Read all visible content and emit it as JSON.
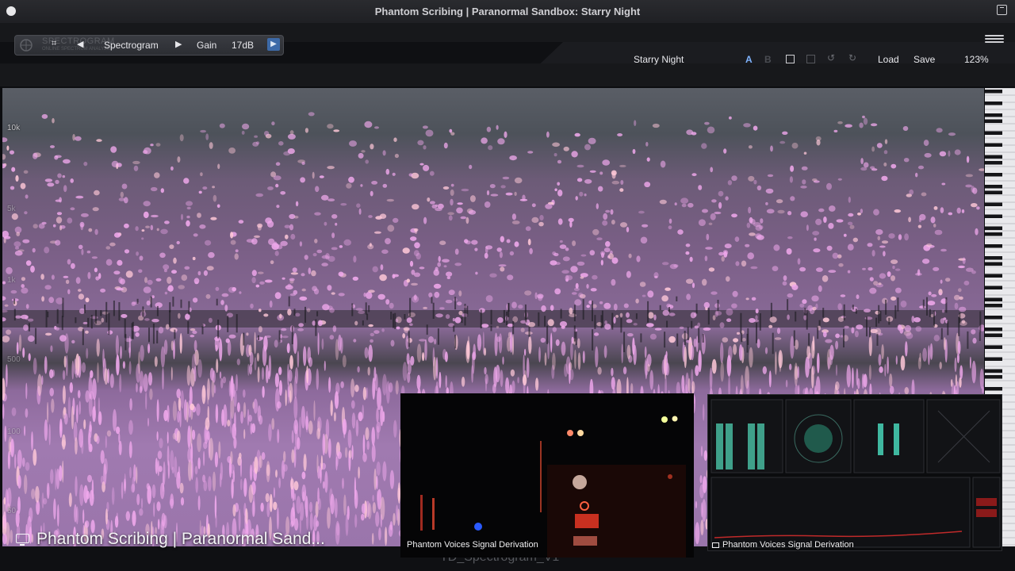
{
  "window": {
    "title": "Phantom Scribing | Paranormal Sandbox: Starry Night"
  },
  "toolbar": {
    "ghost_brand": "SPECTROGRAM",
    "ghost_sub": "ONLINE SPECTRUM ANALYZER",
    "view_label": "Spectrogram",
    "gain_label": "Gain",
    "gain_value": "17dB"
  },
  "preset": {
    "name": "Starry Night",
    "ab_a": "A",
    "ab_b": "B",
    "load_label": "Load",
    "save_label": "Save",
    "zoom": "123%"
  },
  "spectrogram": {
    "freq_labels": [
      "10k",
      "5k",
      "1k",
      "500",
      "100",
      "50"
    ]
  },
  "bottom": {
    "stream_title": "Phantom Scribing | Paranormal Sand...",
    "filename": "TD_Spectrogram_V1"
  },
  "overlays": {
    "camera_label": "Phantom Voices Signal Derivation",
    "meter_label": "Phantom Voices Signal Derivation"
  },
  "colors": {
    "accent_blue": "#3d6aa8",
    "ab_active": "#7fb3ff",
    "spectro_pink": "#e8a0e6",
    "spectro_dark": "#4d525a"
  }
}
